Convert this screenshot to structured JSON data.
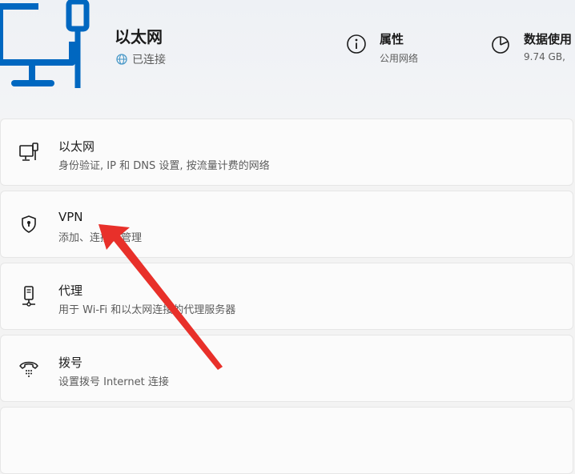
{
  "header": {
    "icon": "ethernet-pc-icon",
    "name": "以太网",
    "status": "已连接",
    "status_icon": "globe-icon",
    "properties": {
      "title": "属性",
      "value": "公用网络",
      "icon": "info-icon"
    },
    "data_usage": {
      "title": "数据使用",
      "value": "9.74 GB,",
      "icon": "pie-chart-icon"
    }
  },
  "items": [
    {
      "title": "以太网",
      "desc": "身份验证, IP 和 DNS 设置, 按流量计费的网络",
      "icon": "ethernet-port-icon"
    },
    {
      "title": "VPN",
      "desc": "添加、连接、管理",
      "icon": "shield-icon"
    },
    {
      "title": "代理",
      "desc": "用于 Wi-Fi 和以太网连接的代理服务器",
      "icon": "proxy-server-icon"
    },
    {
      "title": "拨号",
      "desc": "设置拨号 Internet 连接",
      "icon": "dialup-phone-icon"
    }
  ],
  "colors": {
    "accent": "#0067c0",
    "annotation_arrow": "#e8302a"
  }
}
